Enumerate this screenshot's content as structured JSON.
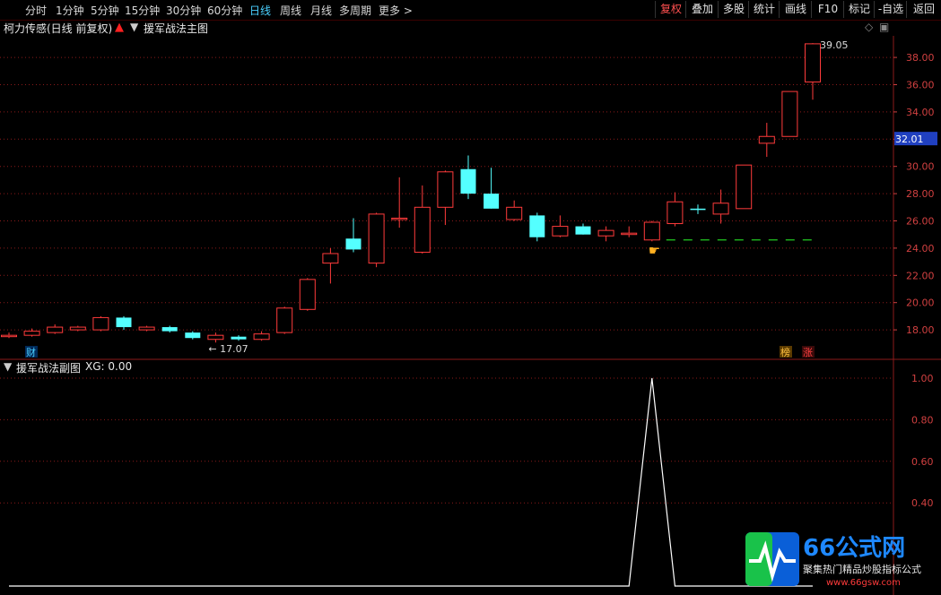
{
  "toolbar": {
    "periods": [
      "分时",
      "1分钟",
      "5分钟",
      "15分钟",
      "30分钟",
      "60分钟",
      "日线",
      "周线",
      "月线",
      "多周期",
      "更多 >"
    ],
    "active_period": "日线",
    "buttons": [
      "复权",
      "叠加",
      "多股",
      "统计",
      "画线",
      "F10",
      "标记",
      "-自选",
      "返回"
    ],
    "highlighted_button": "复权"
  },
  "main_header": {
    "stock": "柯力传感(日线 前复权)",
    "indicator": "援军战法主图"
  },
  "sub_header": {
    "indicator": "援军战法副图",
    "value_label": "XG: 0.00"
  },
  "price_axis": {
    "ticks": [
      "38.00",
      "36.00",
      "34.00",
      "32.00",
      "30.00",
      "28.00",
      "26.00",
      "24.00",
      "22.00",
      "20.00",
      "18.00"
    ],
    "tick_values": [
      38,
      36,
      34,
      32,
      30,
      28,
      26,
      24,
      22,
      20,
      18
    ],
    "current_price": "32.01",
    "current_price_value": 32.01
  },
  "sub_axis": {
    "ticks": [
      "1.00",
      "0.80",
      "0.60",
      "0.40"
    ],
    "tick_values": [
      1.0,
      0.8,
      0.6,
      0.4
    ]
  },
  "annotations": {
    "high": "39.05",
    "low": "17.07",
    "marker_cai": "财",
    "marker_bang": "榜",
    "marker_zhang": "涨"
  },
  "chart_data": {
    "type": "candlestick",
    "candles": [
      {
        "o": 17.6,
        "c": 17.6,
        "h": 17.8,
        "l": 17.4
      },
      {
        "o": 17.6,
        "c": 17.9,
        "h": 18.1,
        "l": 17.5
      },
      {
        "o": 17.8,
        "c": 18.2,
        "h": 18.4,
        "l": 17.7
      },
      {
        "o": 18.0,
        "c": 18.2,
        "h": 18.3,
        "l": 17.9
      },
      {
        "o": 18.0,
        "c": 18.9,
        "h": 19.0,
        "l": 17.9
      },
      {
        "o": 18.9,
        "c": 18.2,
        "h": 19.0,
        "l": 18.0
      },
      {
        "o": 18.0,
        "c": 18.2,
        "h": 18.3,
        "l": 17.9
      },
      {
        "o": 18.2,
        "c": 17.9,
        "h": 18.3,
        "l": 17.8
      },
      {
        "o": 17.8,
        "c": 17.4,
        "h": 17.9,
        "l": 17.3
      },
      {
        "o": 17.3,
        "c": 17.6,
        "h": 17.8,
        "l": 17.07
      },
      {
        "o": 17.5,
        "c": 17.3,
        "h": 17.6,
        "l": 17.2
      },
      {
        "o": 17.3,
        "c": 17.7,
        "h": 17.9,
        "l": 17.2
      },
      {
        "o": 17.8,
        "c": 19.6,
        "h": 19.7,
        "l": 17.7
      },
      {
        "o": 19.5,
        "c": 21.7,
        "h": 21.8,
        "l": 19.4
      },
      {
        "o": 22.9,
        "c": 23.6,
        "h": 24.0,
        "l": 21.4
      },
      {
        "o": 24.7,
        "c": 23.9,
        "h": 26.2,
        "l": 23.7
      },
      {
        "o": 22.9,
        "c": 26.5,
        "h": 26.6,
        "l": 22.6
      },
      {
        "o": 26.1,
        "c": 26.2,
        "h": 29.2,
        "l": 25.5
      },
      {
        "o": 23.7,
        "c": 27.0,
        "h": 28.6,
        "l": 23.6
      },
      {
        "o": 27.0,
        "c": 29.6,
        "h": 29.7,
        "l": 25.7
      },
      {
        "o": 29.8,
        "c": 28.0,
        "h": 30.8,
        "l": 27.6
      },
      {
        "o": 28.0,
        "c": 26.9,
        "h": 29.9,
        "l": 26.9
      },
      {
        "o": 26.1,
        "c": 27.0,
        "h": 27.5,
        "l": 26.0
      },
      {
        "o": 26.4,
        "c": 24.8,
        "h": 26.6,
        "l": 24.5
      },
      {
        "o": 24.9,
        "c": 25.6,
        "h": 26.4,
        "l": 24.8
      },
      {
        "o": 25.6,
        "c": 25.0,
        "h": 25.8,
        "l": 25.0
      },
      {
        "o": 24.9,
        "c": 25.3,
        "h": 25.6,
        "l": 24.5
      },
      {
        "o": 25.0,
        "c": 25.1,
        "h": 25.6,
        "l": 24.8
      },
      {
        "o": 24.6,
        "c": 25.9,
        "h": 26.0,
        "l": 24.5
      },
      {
        "o": 25.8,
        "c": 27.4,
        "h": 28.1,
        "l": 25.6
      },
      {
        "o": 26.9,
        "c": 26.8,
        "h": 27.2,
        "l": 26.5
      },
      {
        "o": 26.5,
        "c": 27.3,
        "h": 28.3,
        "l": 25.8
      },
      {
        "o": 26.9,
        "c": 30.1,
        "h": 30.1,
        "l": 26.9
      },
      {
        "o": 31.7,
        "c": 32.2,
        "h": 33.2,
        "l": 30.7
      },
      {
        "o": 32.2,
        "c": 35.5,
        "h": 35.5,
        "l": 32.2
      },
      {
        "o": 36.2,
        "c": 39.0,
        "h": 39.05,
        "l": 34.9
      }
    ],
    "dashed_level": 24.6,
    "sub_series": [
      0,
      0,
      0,
      0,
      0,
      0,
      0,
      0,
      0,
      0,
      0,
      0,
      0,
      0,
      0,
      0,
      0,
      0,
      0,
      0,
      0,
      0,
      0,
      0,
      0,
      0,
      0,
      0,
      1,
      0,
      0,
      0,
      0,
      0,
      0,
      0
    ]
  },
  "colors": {
    "up": "#ff3b3b",
    "down": "#54ffff",
    "grid": "#8b1a1a",
    "axis": "#d04040",
    "accent": "#4ad0ff",
    "price_tag_bg": "#2040c0",
    "dash": "#22cc22"
  },
  "logo": {
    "title": "66公式网",
    "subtitle": "聚集热门精品炒股指标公式",
    "url": "www.66gsw.com"
  }
}
